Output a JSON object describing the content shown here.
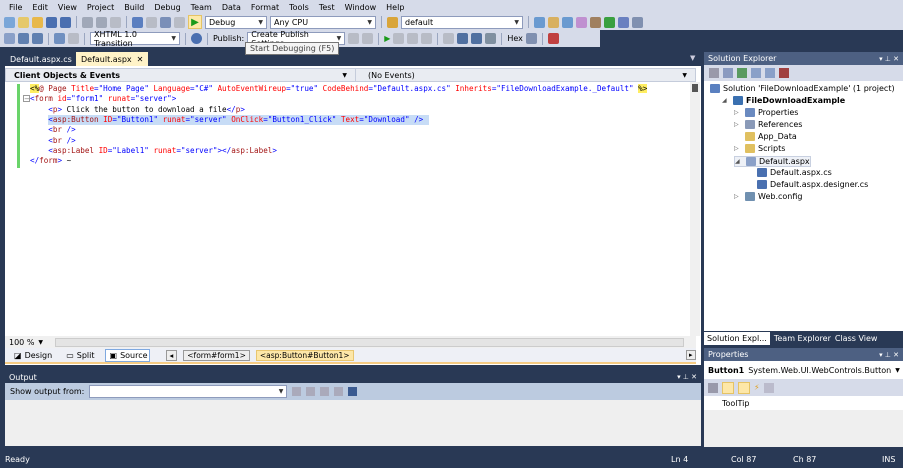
{
  "menu": [
    "File",
    "Edit",
    "View",
    "Project",
    "Build",
    "Debug",
    "Team",
    "Data",
    "Format",
    "Tools",
    "Test",
    "Window",
    "Help"
  ],
  "toolbar1": {
    "config": "Debug",
    "platform": "Any CPU",
    "find": "default"
  },
  "toolbar2": {
    "doctype": "XHTML 1.0 Transition",
    "publish_label": "Publish:",
    "publish_value": "Create Publish Settings",
    "hex": "Hex"
  },
  "tooltip": "Start Debugging (F5)",
  "tabs": [
    {
      "label": "Default.aspx.cs"
    },
    {
      "label": "Default.aspx",
      "close": "✕"
    }
  ],
  "navbar": {
    "left": "Client Objects & Events",
    "right": "(No Events)"
  },
  "code": [
    [
      [
        "<%",
        "dir"
      ],
      [
        "@ Page ",
        "tag"
      ],
      [
        "Title",
        "attr"
      ],
      [
        "=\"Home Page\" ",
        "val"
      ],
      [
        "Language",
        "attr"
      ],
      [
        "=\"C#\" ",
        "val"
      ],
      [
        "AutoEventWireup",
        "attr"
      ],
      [
        "=\"true\" ",
        "val"
      ],
      [
        "CodeBehind",
        "attr"
      ],
      [
        "=\"Default.aspx.cs\" ",
        "val"
      ],
      [
        "Inherits",
        "attr"
      ],
      [
        "=\"FileDownloadExample._Default\" ",
        "val"
      ],
      [
        "%>",
        "dir"
      ]
    ],
    [
      [
        "<",
        "del"
      ],
      [
        "form ",
        "tag"
      ],
      [
        "id",
        "attr"
      ],
      [
        "=\"form1\" ",
        "val"
      ],
      [
        "runat",
        "attr"
      ],
      [
        "=\"server\"",
        "val"
      ],
      [
        ">",
        "del"
      ]
    ],
    [
      [
        "    <",
        "del"
      ],
      [
        "p",
        "tag"
      ],
      [
        "> ",
        "del"
      ],
      [
        "Click the button to download a file",
        "txt"
      ],
      [
        "</",
        "del"
      ],
      [
        "p",
        "tag"
      ],
      [
        ">",
        "del"
      ]
    ],
    [
      [
        "    <",
        "del"
      ],
      [
        "asp:Button ",
        "tag"
      ],
      [
        "ID",
        "attr"
      ],
      [
        "=\"Button1\" ",
        "val"
      ],
      [
        "runat",
        "attr"
      ],
      [
        "=\"server\" ",
        "val"
      ],
      [
        "OnClick",
        "attr"
      ],
      [
        "=\"Button1_Click\" ",
        "val"
      ],
      [
        "Text",
        "attr"
      ],
      [
        "=\"Download\" ",
        "val"
      ],
      [
        "/>",
        "del"
      ]
    ],
    [
      [
        "    <",
        "del"
      ],
      [
        "br ",
        "tag"
      ],
      [
        "/>",
        "del"
      ]
    ],
    [
      [
        "    <",
        "del"
      ],
      [
        "br ",
        "tag"
      ],
      [
        "/>",
        "del"
      ]
    ],
    [
      [
        "    <",
        "del"
      ],
      [
        "asp:Label ",
        "tag"
      ],
      [
        "ID",
        "attr"
      ],
      [
        "=\"Label1\" ",
        "val"
      ],
      [
        "runat",
        "attr"
      ],
      [
        "=\"server\"",
        "val"
      ],
      [
        "></",
        "del"
      ],
      [
        "asp:Label",
        "tag"
      ],
      [
        ">",
        "del"
      ]
    ],
    [
      [
        "</",
        "del"
      ],
      [
        "form",
        "tag"
      ],
      [
        ">",
        "del"
      ],
      [
        " ~",
        "txt"
      ]
    ]
  ],
  "editor_footer": {
    "zoom": "100 %",
    "design": "Design",
    "split": "Split",
    "source": "Source",
    "crumbs": [
      "<form#form1>",
      "<asp:Button#Button1>"
    ]
  },
  "output": {
    "title": "Output",
    "show_from": "Show output from:"
  },
  "solution_explorer": {
    "title": "Solution Explorer",
    "items": [
      {
        "label": "Solution 'FileDownloadExample' (1 project)",
        "level": 0,
        "exp": ""
      },
      {
        "label": "FileDownloadExample",
        "level": 1,
        "exp": "◢",
        "bold": true
      },
      {
        "label": "Properties",
        "level": 2,
        "exp": "▷"
      },
      {
        "label": "References",
        "level": 2,
        "exp": "▷"
      },
      {
        "label": "App_Data",
        "level": 2,
        "exp": ""
      },
      {
        "label": "Scripts",
        "level": 2,
        "exp": "▷"
      },
      {
        "label": "Default.aspx",
        "level": 2,
        "exp": "◢"
      },
      {
        "label": "Default.aspx.cs",
        "level": 3,
        "exp": ""
      },
      {
        "label": "Default.aspx.designer.cs",
        "level": 3,
        "exp": ""
      },
      {
        "label": "Web.config",
        "level": 2,
        "exp": "▷"
      }
    ],
    "tabs": [
      "Solution Expl...",
      "Team Explorer",
      "Class View"
    ]
  },
  "properties": {
    "title": "Properties",
    "object": "Button1",
    "type": "System.Web.UI.WebControls.Button",
    "row": "ToolTip"
  },
  "status": {
    "text": "Ready",
    "ln": "Ln 4",
    "col": "Col 87",
    "ch": "Ch 87",
    "mode": "INS"
  },
  "colors": {
    "chrome": "#293955",
    "toolbar": "#d6dbe9",
    "selection": "#c7dcf6"
  }
}
